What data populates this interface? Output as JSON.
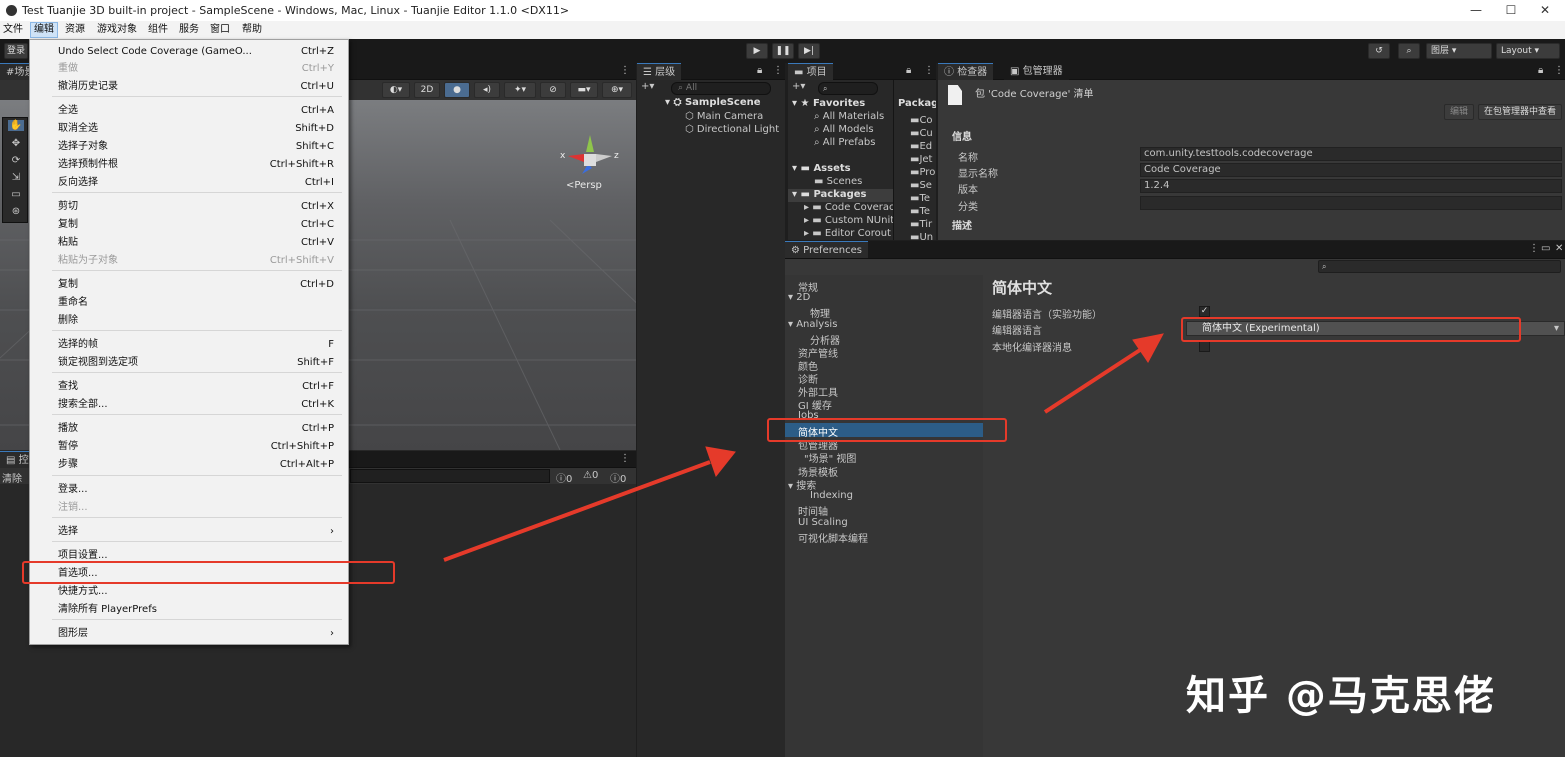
{
  "window": {
    "title": "Test Tuanjie 3D built-in project - SampleScene - Windows, Mac, Linux - Tuanjie Editor 1.1.0 <DX11>",
    "controls": [
      "—",
      "☐",
      "✕"
    ]
  },
  "menubar": [
    "文件",
    "编辑",
    "资源",
    "游戏对象",
    "组件",
    "服务",
    "窗口",
    "帮助"
  ],
  "toolbar": {
    "login": "登录",
    "layers": "图层",
    "layout": "Layout"
  },
  "scene_tab": {
    "label": "场景",
    "mode_2d": "2D",
    "persp": "<Persp"
  },
  "edit_menu": {
    "items": [
      {
        "label": "Undo Select Code Coverage (GameO...",
        "shortcut": "Ctrl+Z",
        "disabled": false
      },
      {
        "label": "重做",
        "shortcut": "Ctrl+Y",
        "disabled": true
      },
      {
        "label": "撤消历史记录",
        "shortcut": "Ctrl+U",
        "disabled": false
      },
      {
        "label": "全选",
        "shortcut": "Ctrl+A",
        "disabled": false
      },
      {
        "label": "取消全选",
        "shortcut": "Shift+D",
        "disabled": false
      },
      {
        "label": "选择子对象",
        "shortcut": "Shift+C",
        "disabled": false
      },
      {
        "label": "选择预制件根",
        "shortcut": "Ctrl+Shift+R",
        "disabled": false
      },
      {
        "label": "反向选择",
        "shortcut": "Ctrl+I",
        "disabled": false
      },
      {
        "label": "剪切",
        "shortcut": "Ctrl+X",
        "disabled": false
      },
      {
        "label": "复制",
        "shortcut": "Ctrl+C",
        "disabled": false
      },
      {
        "label": "粘贴",
        "shortcut": "Ctrl+V",
        "disabled": false
      },
      {
        "label": "粘贴为子对象",
        "shortcut": "Ctrl+Shift+V",
        "disabled": true
      },
      {
        "label": "复制",
        "shortcut": "Ctrl+D",
        "disabled": false
      },
      {
        "label": "重命名",
        "shortcut": "",
        "disabled": false
      },
      {
        "label": "删除",
        "shortcut": "",
        "disabled": false
      },
      {
        "label": "选择的帧",
        "shortcut": "F",
        "disabled": false
      },
      {
        "label": "锁定视图到选定项",
        "shortcut": "Shift+F",
        "disabled": false
      },
      {
        "label": "查找",
        "shortcut": "Ctrl+F",
        "disabled": false
      },
      {
        "label": "搜索全部...",
        "shortcut": "Ctrl+K",
        "disabled": false
      },
      {
        "label": "播放",
        "shortcut": "Ctrl+P",
        "disabled": false
      },
      {
        "label": "暂停",
        "shortcut": "Ctrl+Shift+P",
        "disabled": false
      },
      {
        "label": "步骤",
        "shortcut": "Ctrl+Alt+P",
        "disabled": false
      },
      {
        "label": "登录...",
        "shortcut": "",
        "disabled": false
      },
      {
        "label": "注销...",
        "shortcut": "",
        "disabled": true
      },
      {
        "label": "选择",
        "shortcut": "›",
        "disabled": false
      },
      {
        "label": "项目设置...",
        "shortcut": "",
        "disabled": false
      },
      {
        "label": "首选项...",
        "shortcut": "",
        "disabled": false
      },
      {
        "label": "快捷方式...",
        "shortcut": "",
        "disabled": false
      },
      {
        "label": "清除所有 PlayerPrefs",
        "shortcut": "",
        "disabled": false
      },
      {
        "label": "图形层",
        "shortcut": "›",
        "disabled": false
      }
    ]
  },
  "console": {
    "tab": "控",
    "clear": "清除",
    "counts": [
      "0",
      "0",
      "0"
    ]
  },
  "hierarchy": {
    "tab": "层级",
    "search": "All",
    "scene": "SampleScene",
    "objects": [
      "Main Camera",
      "Directional Light"
    ]
  },
  "project": {
    "tab": "项目",
    "favorites": "Favorites",
    "fav_items": [
      "All Materials",
      "All Models",
      "All Prefabs"
    ],
    "assets": "Assets",
    "asset_items": [
      "Scenes"
    ],
    "packages": "Packages",
    "package_items": [
      "Code Coverac",
      "Custom NUnit",
      "Editor Corout"
    ],
    "right_header": "Packag",
    "right_items": [
      "Co",
      "Cu",
      "Ed",
      "Jet",
      "Pro",
      "Se",
      "Te",
      "Te",
      "Tir",
      "Un"
    ]
  },
  "inspector": {
    "tabs": [
      "检查器",
      "包管理器"
    ],
    "header": "包 'Code Coverage' 清单",
    "btn_edit": "编辑",
    "btn_view": "在包管理器中查看",
    "section_info": "信息",
    "fields": [
      {
        "label": "名称",
        "value": "com.unity.testtools.codecoverage"
      },
      {
        "label": "显示名称",
        "value": "Code Coverage"
      },
      {
        "label": "版本",
        "value": "1.2.4"
      },
      {
        "label": "分类",
        "value": ""
      }
    ],
    "section_desc": "描述"
  },
  "preferences": {
    "title": "Preferences",
    "search_icon": "search-icon",
    "nav": [
      "常规",
      "2D",
      "物理",
      "Analysis",
      "分析器",
      "资产管线",
      "颜色",
      "诊断",
      "外部工具",
      "GI 缓存",
      "Jobs",
      "简体中文",
      "包管理器",
      "\"场景\" 视图",
      "场景模板",
      "搜索",
      "Indexing",
      "时间轴",
      "UI Scaling",
      "可视化脚本编程"
    ],
    "selected": "简体中文",
    "content_title": "简体中文",
    "settings": [
      {
        "label": "编辑器语言（实验功能）",
        "value": "✓"
      },
      {
        "label": "编辑器语言",
        "value": "简体中文 (Experimental)"
      },
      {
        "label": "本地化编译器消息",
        "value": ""
      }
    ]
  },
  "watermark": "知乎 @马克思佬",
  "colors": {
    "accent": "#3a79bb",
    "selection": "#2c5d87",
    "highlight": "#e53a2a"
  }
}
